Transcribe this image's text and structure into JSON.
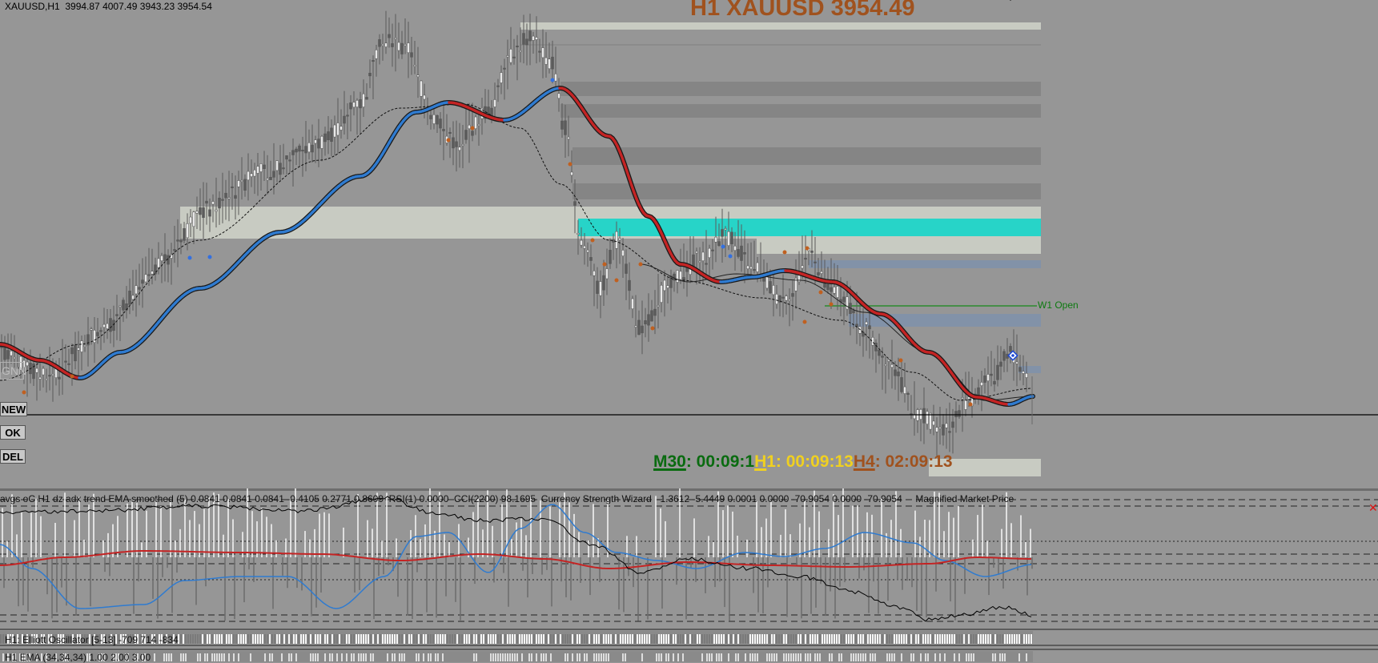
{
  "header": {
    "symbol_line": "XAUUSD,H1  3994.87 4007.49 3943.23 3954.54",
    "big_title": "H1 XAUUSD 3954.49"
  },
  "levels": {
    "w1_open_label": "W1 Open"
  },
  "side_panel": {
    "gnn_label": "GNN",
    "new_label": "NEW",
    "ok_label": "OK",
    "del_label": "DEL"
  },
  "timers": {
    "m30_tf": "M30",
    "m30_rest": ": 00:09:1",
    "h1_tf": "H",
    "h1_rest": "1: 00:09:13",
    "h4_tf": "H4",
    "h4_rest": ": 02:09:13"
  },
  "indicators": {
    "line1": "avgs oC H1 dz adx trend EMA smoothed (5) 0.0841 0.0841 0.0841 -0.4105 0.2771 0.8609  RSI(1) 0.0000  CCI(2200) 98.1695  Currency Strength Wizard  -1.3612 -5.4449 0.0001 0.0000 -70.9054 0.0000 -70.9054     Magnified Market Price",
    "line2": "H1: Elliott Oscillator [5-13] -709 714 -834",
    "line3": "H1 EMA (34,34,34) 1.00 2.00 3.00",
    "close_glyph": "✕"
  },
  "colors": {
    "background": "#969696",
    "bull_ma": "#2f7bd0",
    "bear_ma": "#c42424",
    "cyan_zone": "#27d4c8",
    "light_zone": "#c8cbc2",
    "dark_zone": "#858585",
    "blue_zone": "#8292a8",
    "w1_line": "#168a1a",
    "title": "#a0521e",
    "timer_m30": "#0a6b10",
    "timer_h1": "#f0d020",
    "timer_h4": "#a0521e"
  }
}
